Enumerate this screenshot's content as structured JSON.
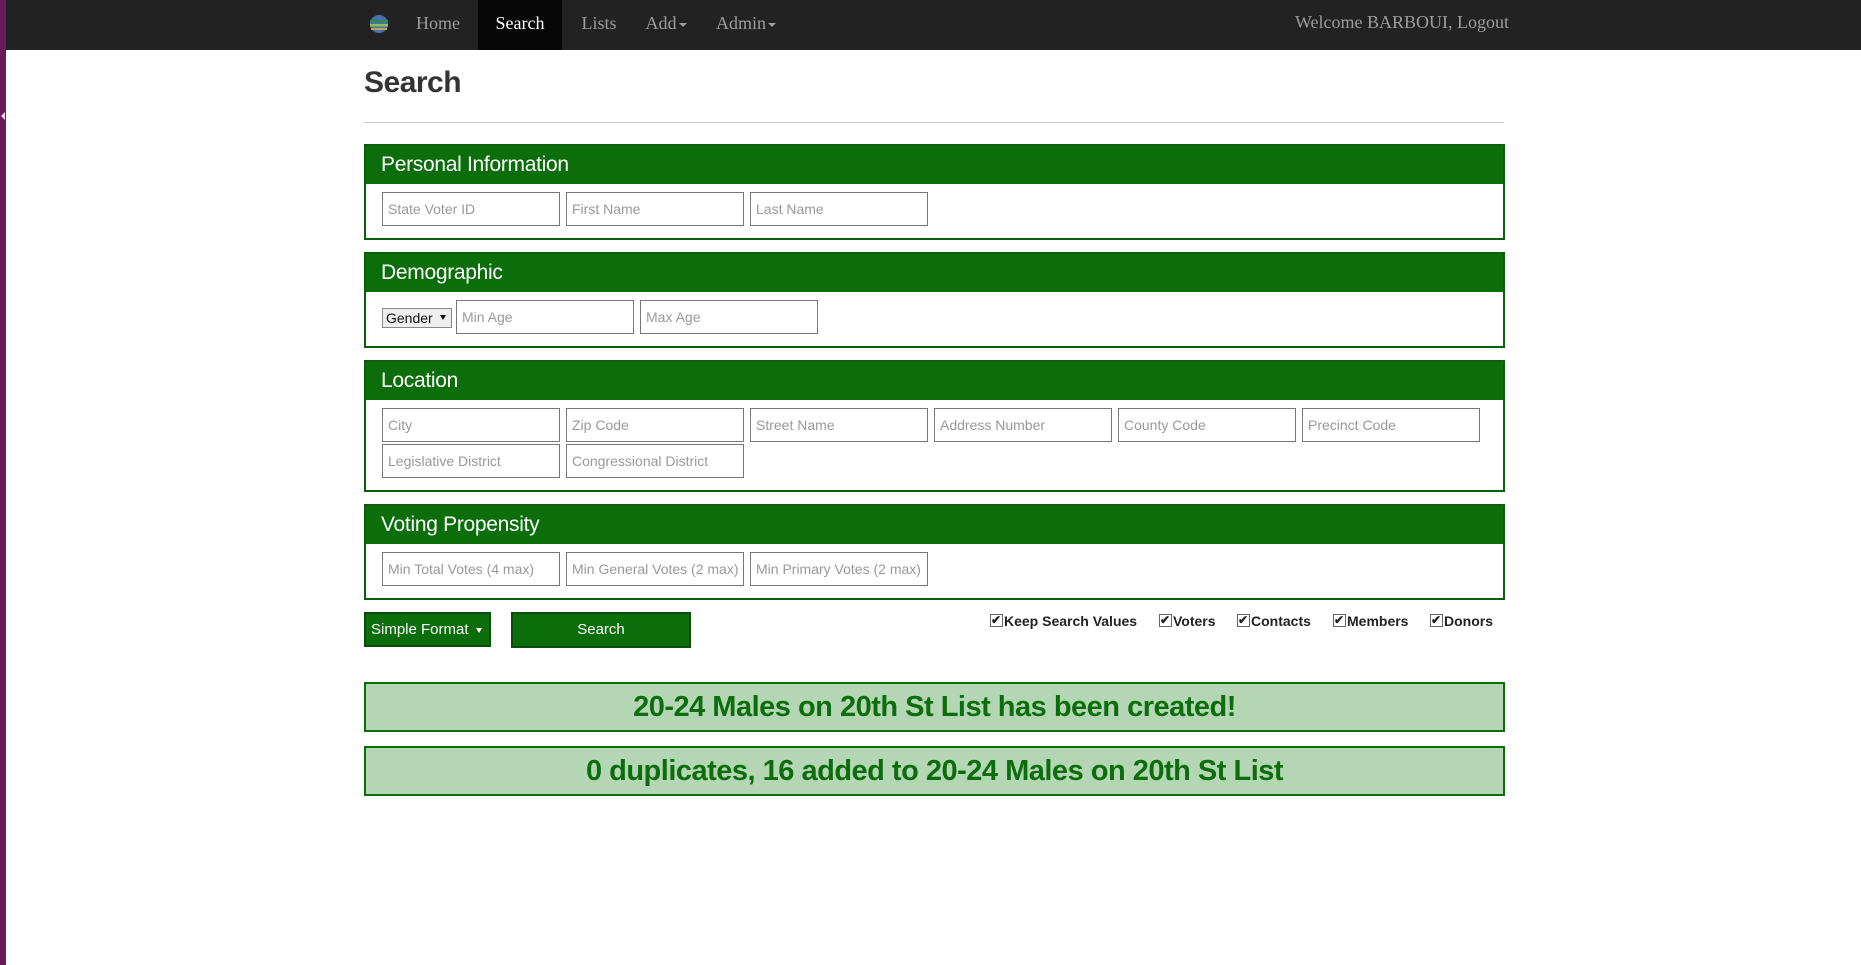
{
  "nav": {
    "brand_icon": "globe-logo-icon",
    "items": [
      {
        "label": "Home"
      },
      {
        "label": "Search"
      },
      {
        "label": "Lists"
      },
      {
        "label": "Add"
      },
      {
        "label": "Admin"
      }
    ],
    "active": "Search",
    "welcome": "Welcome BARBOUI, Logout"
  },
  "page": {
    "title": "Search"
  },
  "sections": {
    "personal": {
      "title": "Personal Information",
      "fields": [
        {
          "placeholder": "State Voter ID"
        },
        {
          "placeholder": "First Name"
        },
        {
          "placeholder": "Last Name"
        }
      ]
    },
    "demographic": {
      "title": "Demographic",
      "gender": "Gender",
      "fields": [
        {
          "placeholder": "Min Age"
        },
        {
          "placeholder": "Max Age"
        }
      ]
    },
    "location": {
      "title": "Location",
      "fields": [
        {
          "placeholder": "City"
        },
        {
          "placeholder": "Zip Code"
        },
        {
          "placeholder": "Street Name"
        },
        {
          "placeholder": "Address Number"
        },
        {
          "placeholder": "County Code"
        },
        {
          "placeholder": "Precinct Code"
        },
        {
          "placeholder": "Legislative District"
        },
        {
          "placeholder": "Congressional District"
        }
      ]
    },
    "propensity": {
      "title": "Voting Propensity",
      "fields": [
        {
          "placeholder": "Min Total Votes (4 max)"
        },
        {
          "placeholder": "Min General Votes (2 max)"
        },
        {
          "placeholder": "Min Primary Votes (2 max)"
        }
      ]
    }
  },
  "controls": {
    "format": "Simple Format",
    "search_label": "Search",
    "checkboxes": [
      {
        "label": "Keep Search Values",
        "checked": true
      },
      {
        "label": "Voters",
        "checked": true
      },
      {
        "label": "Contacts",
        "checked": true
      },
      {
        "label": "Members",
        "checked": true
      },
      {
        "label": "Donors",
        "checked": true
      }
    ]
  },
  "alerts": [
    {
      "text": "20-24 Males on 20th St List has been created!"
    },
    {
      "text": "0 duplicates, 16 added to 20-24 Males on 20th St List"
    }
  ],
  "colors": {
    "panel_header": "#0b6e0b",
    "navbar": "#222222",
    "alert_bg": "#b5d6b5",
    "alert_text": "#0b6e0b",
    "left_strip": "#6a1a5c"
  }
}
